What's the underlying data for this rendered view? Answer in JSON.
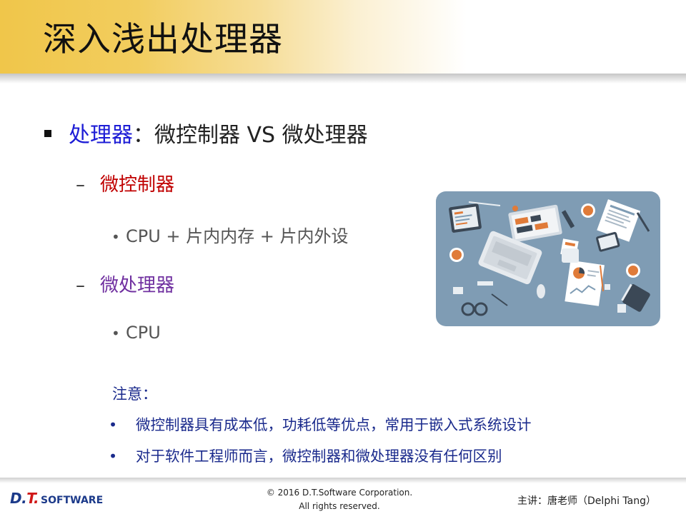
{
  "title": "深入浅出处理器",
  "point1": {
    "prefix": "处理器",
    "rest": "：微控制器 VS 微处理器"
  },
  "sub1": {
    "label": "微控制器",
    "detail": "CPU + 片内内存 + 片内外设"
  },
  "sub2": {
    "label": "微处理器",
    "detail": "CPU"
  },
  "note": {
    "heading": "注意：",
    "items": [
      "微控制器具有成本低，功耗低等优点，常用于嵌入式系统设计",
      "对于软件工程师而言，微控制器和微处理器没有任何区别"
    ]
  },
  "illustration": {
    "icon": "workspace-desk-illustration"
  },
  "footer": {
    "logo_dt_1": "D.",
    "logo_dt_2": "T.",
    "logo_sw": "SOFTWARE",
    "copyright_line1": "© 2016 D.T.Software Corporation.",
    "copyright_line2": "All rights reserved.",
    "speaker": "主讲：唐老师（Delphi Tang）"
  },
  "colors": {
    "title_band": "#f0c64a",
    "highlight_blue": "#1d1dd6",
    "highlight_red": "#c00000",
    "highlight_purple": "#7030a0",
    "note_text": "#1a2a8c",
    "illustration_bg": "#7f9cb4"
  }
}
